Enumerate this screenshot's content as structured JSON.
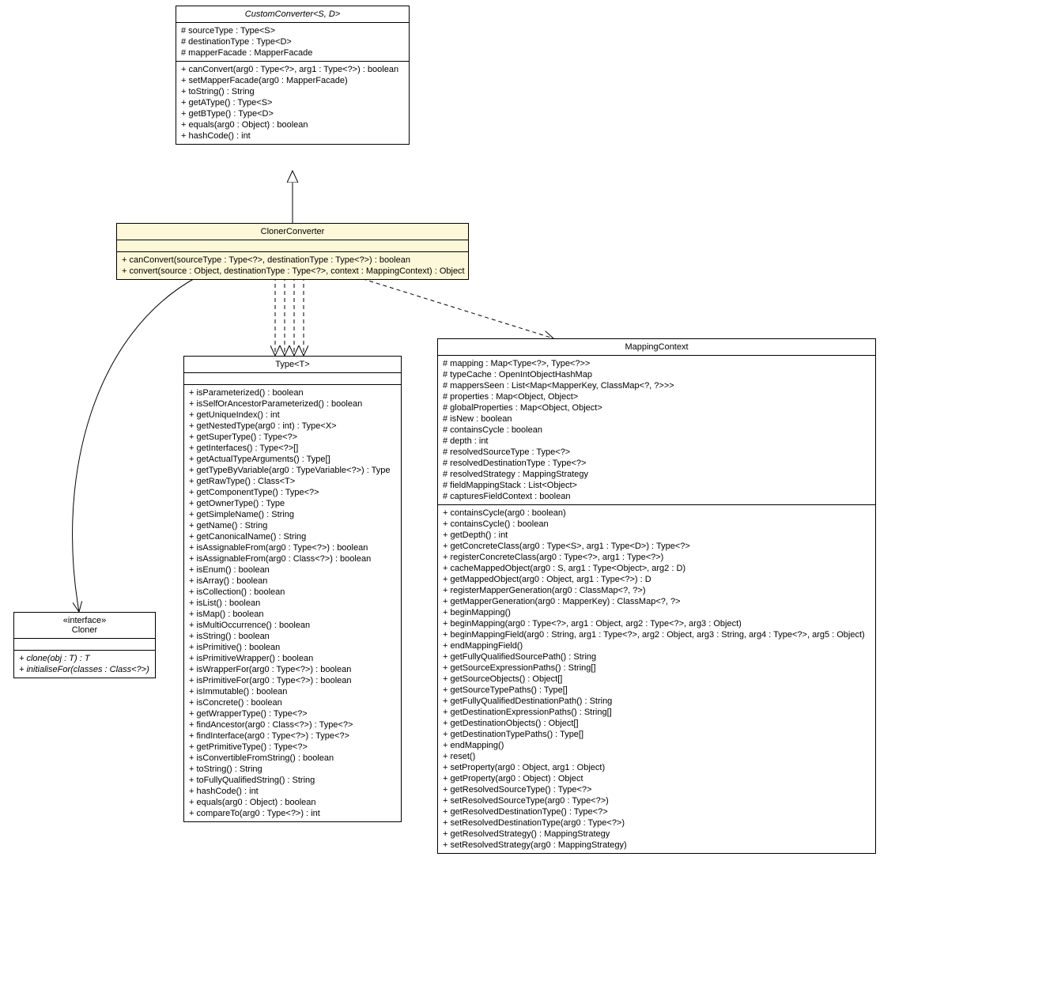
{
  "customConverter": {
    "title": "CustomConverter<S, D>",
    "attrs": [
      "# sourceType : Type<S>",
      "# destinationType : Type<D>",
      "# mapperFacade : MapperFacade"
    ],
    "ops": [
      "+ canConvert(arg0 : Type<?>, arg1 : Type<?>) : boolean",
      "+ setMapperFacade(arg0 : MapperFacade)",
      "+ toString() : String",
      "+ getAType() : Type<S>",
      "+ getBType() : Type<D>",
      "+ equals(arg0 : Object) : boolean",
      "+ hashCode() : int"
    ]
  },
  "clonerConverter": {
    "title": "ClonerConverter",
    "ops": [
      "+ canConvert(sourceType : Type<?>, destinationType : Type<?>) : boolean",
      "+ convert(source : Object, destinationType : Type<?>, context : MappingContext) : Object"
    ]
  },
  "cloner": {
    "stereo": "«interface»",
    "title": "Cloner",
    "ops": [
      "+ clone(obj : T) : T",
      "+ initialiseFor(classes : Class<?>)"
    ]
  },
  "type": {
    "title": "Type<T>",
    "ops": [
      "+ isParameterized() : boolean",
      "+ isSelfOrAncestorParameterized() : boolean",
      "+ getUniqueIndex() : int",
      "+ getNestedType(arg0 : int) : Type<X>",
      "+ getSuperType() : Type<?>",
      "+ getInterfaces() : Type<?>[]",
      "+ getActualTypeArguments() : Type[]",
      "+ getTypeByVariable(arg0 : TypeVariable<?>) : Type",
      "+ getRawType() : Class<T>",
      "+ getComponentType() : Type<?>",
      "+ getOwnerType() : Type",
      "+ getSimpleName() : String",
      "+ getName() : String",
      "+ getCanonicalName() : String",
      "+ isAssignableFrom(arg0 : Type<?>) : boolean",
      "+ isAssignableFrom(arg0 : Class<?>) : boolean",
      "+ isEnum() : boolean",
      "+ isArray() : boolean",
      "+ isCollection() : boolean",
      "+ isList() : boolean",
      "+ isMap() : boolean",
      "+ isMultiOccurrence() : boolean",
      "+ isString() : boolean",
      "+ isPrimitive() : boolean",
      "+ isPrimitiveWrapper() : boolean",
      "+ isWrapperFor(arg0 : Type<?>) : boolean",
      "+ isPrimitiveFor(arg0 : Type<?>) : boolean",
      "+ isImmutable() : boolean",
      "+ isConcrete() : boolean",
      "+ getWrapperType() : Type<?>",
      "+ findAncestor(arg0 : Class<?>) : Type<?>",
      "+ findInterface(arg0 : Type<?>) : Type<?>",
      "+ getPrimitiveType() : Type<?>",
      "+ isConvertibleFromString() : boolean",
      "+ toString() : String",
      "+ toFullyQualifiedString() : String",
      "+ hashCode() : int",
      "+ equals(arg0 : Object) : boolean",
      "+ compareTo(arg0 : Type<?>) : int"
    ]
  },
  "mappingContext": {
    "title": "MappingContext",
    "attrs": [
      "# mapping : Map<Type<?>, Type<?>>",
      "# typeCache : OpenIntObjectHashMap",
      "# mappersSeen : List<Map<MapperKey, ClassMap<?, ?>>>",
      "# properties : Map<Object, Object>",
      "# globalProperties : Map<Object, Object>",
      "# isNew : boolean",
      "# containsCycle : boolean",
      "# depth : int",
      "# resolvedSourceType : Type<?>",
      "# resolvedDestinationType : Type<?>",
      "# resolvedStrategy : MappingStrategy",
      "# fieldMappingStack : List<Object>",
      "# capturesFieldContext : boolean"
    ],
    "ops": [
      "+ containsCycle(arg0 : boolean)",
      "+ containsCycle() : boolean",
      "+ getDepth() : int",
      "+ getConcreteClass(arg0 : Type<S>, arg1 : Type<D>) : Type<?>",
      "+ registerConcreteClass(arg0 : Type<?>, arg1 : Type<?>)",
      "+ cacheMappedObject(arg0 : S, arg1 : Type<Object>, arg2 : D)",
      "+ getMappedObject(arg0 : Object, arg1 : Type<?>) : D",
      "+ registerMapperGeneration(arg0 : ClassMap<?, ?>)",
      "+ getMapperGeneration(arg0 : MapperKey) : ClassMap<?, ?>",
      "+ beginMapping()",
      "+ beginMapping(arg0 : Type<?>, arg1 : Object, arg2 : Type<?>, arg3 : Object)",
      "+ beginMappingField(arg0 : String, arg1 : Type<?>, arg2 : Object, arg3 : String, arg4 : Type<?>, arg5 : Object)",
      "+ endMappingField()",
      "+ getFullyQualifiedSourcePath() : String",
      "+ getSourceExpressionPaths() : String[]",
      "+ getSourceObjects() : Object[]",
      "+ getSourceTypePaths() : Type[]",
      "+ getFullyQualifiedDestinationPath() : String",
      "+ getDestinationExpressionPaths() : String[]",
      "+ getDestinationObjects() : Object[]",
      "+ getDestinationTypePaths() : Type[]",
      "+ endMapping()",
      "+ reset()",
      "+ setProperty(arg0 : Object, arg1 : Object)",
      "+ getProperty(arg0 : Object) : Object",
      "+ getResolvedSourceType() : Type<?>",
      "+ setResolvedSourceType(arg0 : Type<?>)",
      "+ getResolvedDestinationType() : Type<?>",
      "+ setResolvedDestinationType(arg0 : Type<?>)",
      "+ getResolvedStrategy() : MappingStrategy",
      "+ setResolvedStrategy(arg0 : MappingStrategy)"
    ]
  }
}
